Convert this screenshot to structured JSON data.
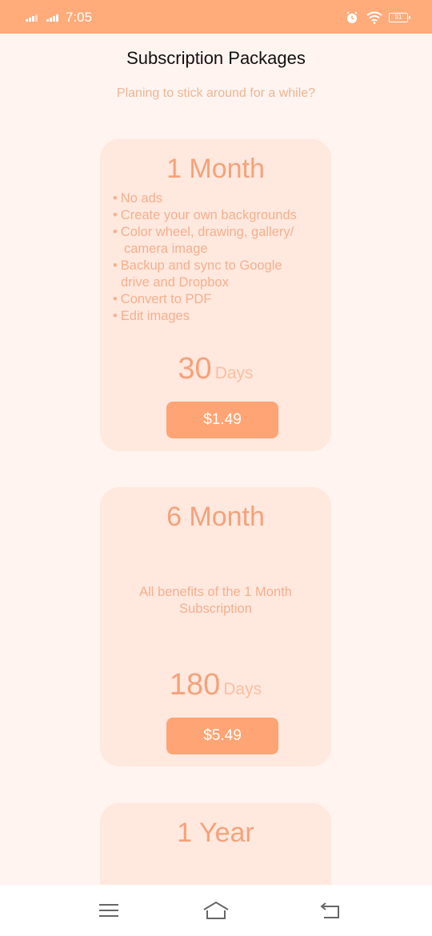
{
  "status_bar": {
    "time": "7:05",
    "battery": "91",
    "icons": [
      "signal-icon",
      "alarm-icon",
      "wifi-icon",
      "battery-icon"
    ]
  },
  "header": {
    "title": "Subscription Packages",
    "subtitle": "Planing to stick around for a while?"
  },
  "packages": [
    {
      "title": "1 Month",
      "features": [
        {
          "bullet": "•",
          "text": "No ads"
        },
        {
          "bullet": "•",
          "text": "Create your own backgrounds"
        },
        {
          "bullet": "•",
          "text": "Color wheel, drawing, gallery/"
        },
        {
          "bullet": "",
          "text": "camera image"
        },
        {
          "bullet": "•",
          "text": "Backup and sync to Google"
        },
        {
          "bullet": "",
          "text": "drive and Dropbox"
        },
        {
          "bullet": "•",
          "text": "Convert to PDF"
        },
        {
          "bullet": "•",
          "text": "Edit images"
        }
      ],
      "duration_value": "30",
      "duration_unit": "Days",
      "price": "$1.49"
    },
    {
      "title": "6 Month",
      "description_line1": "All benefits of the 1 Month",
      "description_line2": "Subscription",
      "duration_value": "180",
      "duration_unit": "Days",
      "price": "$5.49"
    },
    {
      "title": "1 Year"
    }
  ],
  "nav_bar": {
    "icons": [
      "menu-icon",
      "home-icon",
      "back-icon"
    ]
  },
  "colors": {
    "accent": "#ffab7a",
    "card_bg": "#ffe8de",
    "button": "#ffa474",
    "page_bg": "#fff4f0",
    "text_soft": "#f5b08e"
  }
}
